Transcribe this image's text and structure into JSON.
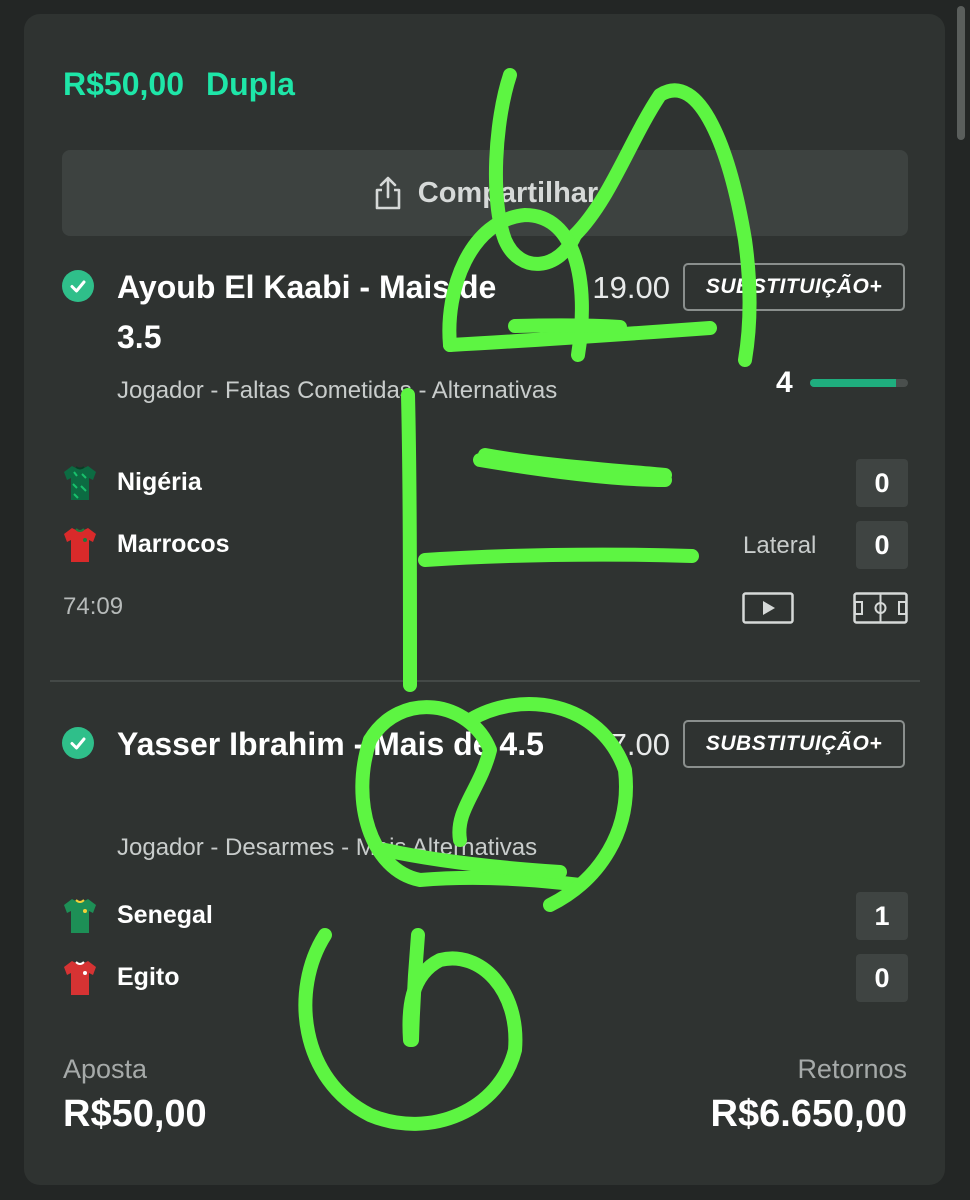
{
  "bet": {
    "amount": "R$50,00",
    "type": "Dupla"
  },
  "share": {
    "label": "Compartilhar"
  },
  "selections": [
    {
      "title": "Ayoub El Kaabi - Mais de 3.5",
      "odds": "19.00",
      "sub_label": "SUBSTITUIÇÃO+",
      "market": "Jogador - Faltas Cometidas - Alternativas",
      "progress_value": "4",
      "progress_fraction": 0.875,
      "teams": [
        {
          "name": "Nigéria",
          "score": "0"
        },
        {
          "name": "Marrocos",
          "score": "0"
        }
      ],
      "status": "Lateral",
      "clock": "74:09"
    },
    {
      "title": "Yasser Ibrahim - Mais de 4.5",
      "odds": "7.00",
      "sub_label": "SUBSTITUIÇÃO+",
      "market": "Jogador - Desarmes - Mais Alternativas",
      "teams": [
        {
          "name": "Senegal",
          "score": "1"
        },
        {
          "name": "Egito",
          "score": "0"
        }
      ]
    }
  ],
  "footer": {
    "stake_label": "Aposta",
    "stake_value": "R$50,00",
    "returns_label": "Retornos",
    "returns_value": "R$6.650,00"
  },
  "colors": {
    "accent": "#1ee6a8",
    "check": "#2fbf8a",
    "scribble": "#5df542"
  }
}
